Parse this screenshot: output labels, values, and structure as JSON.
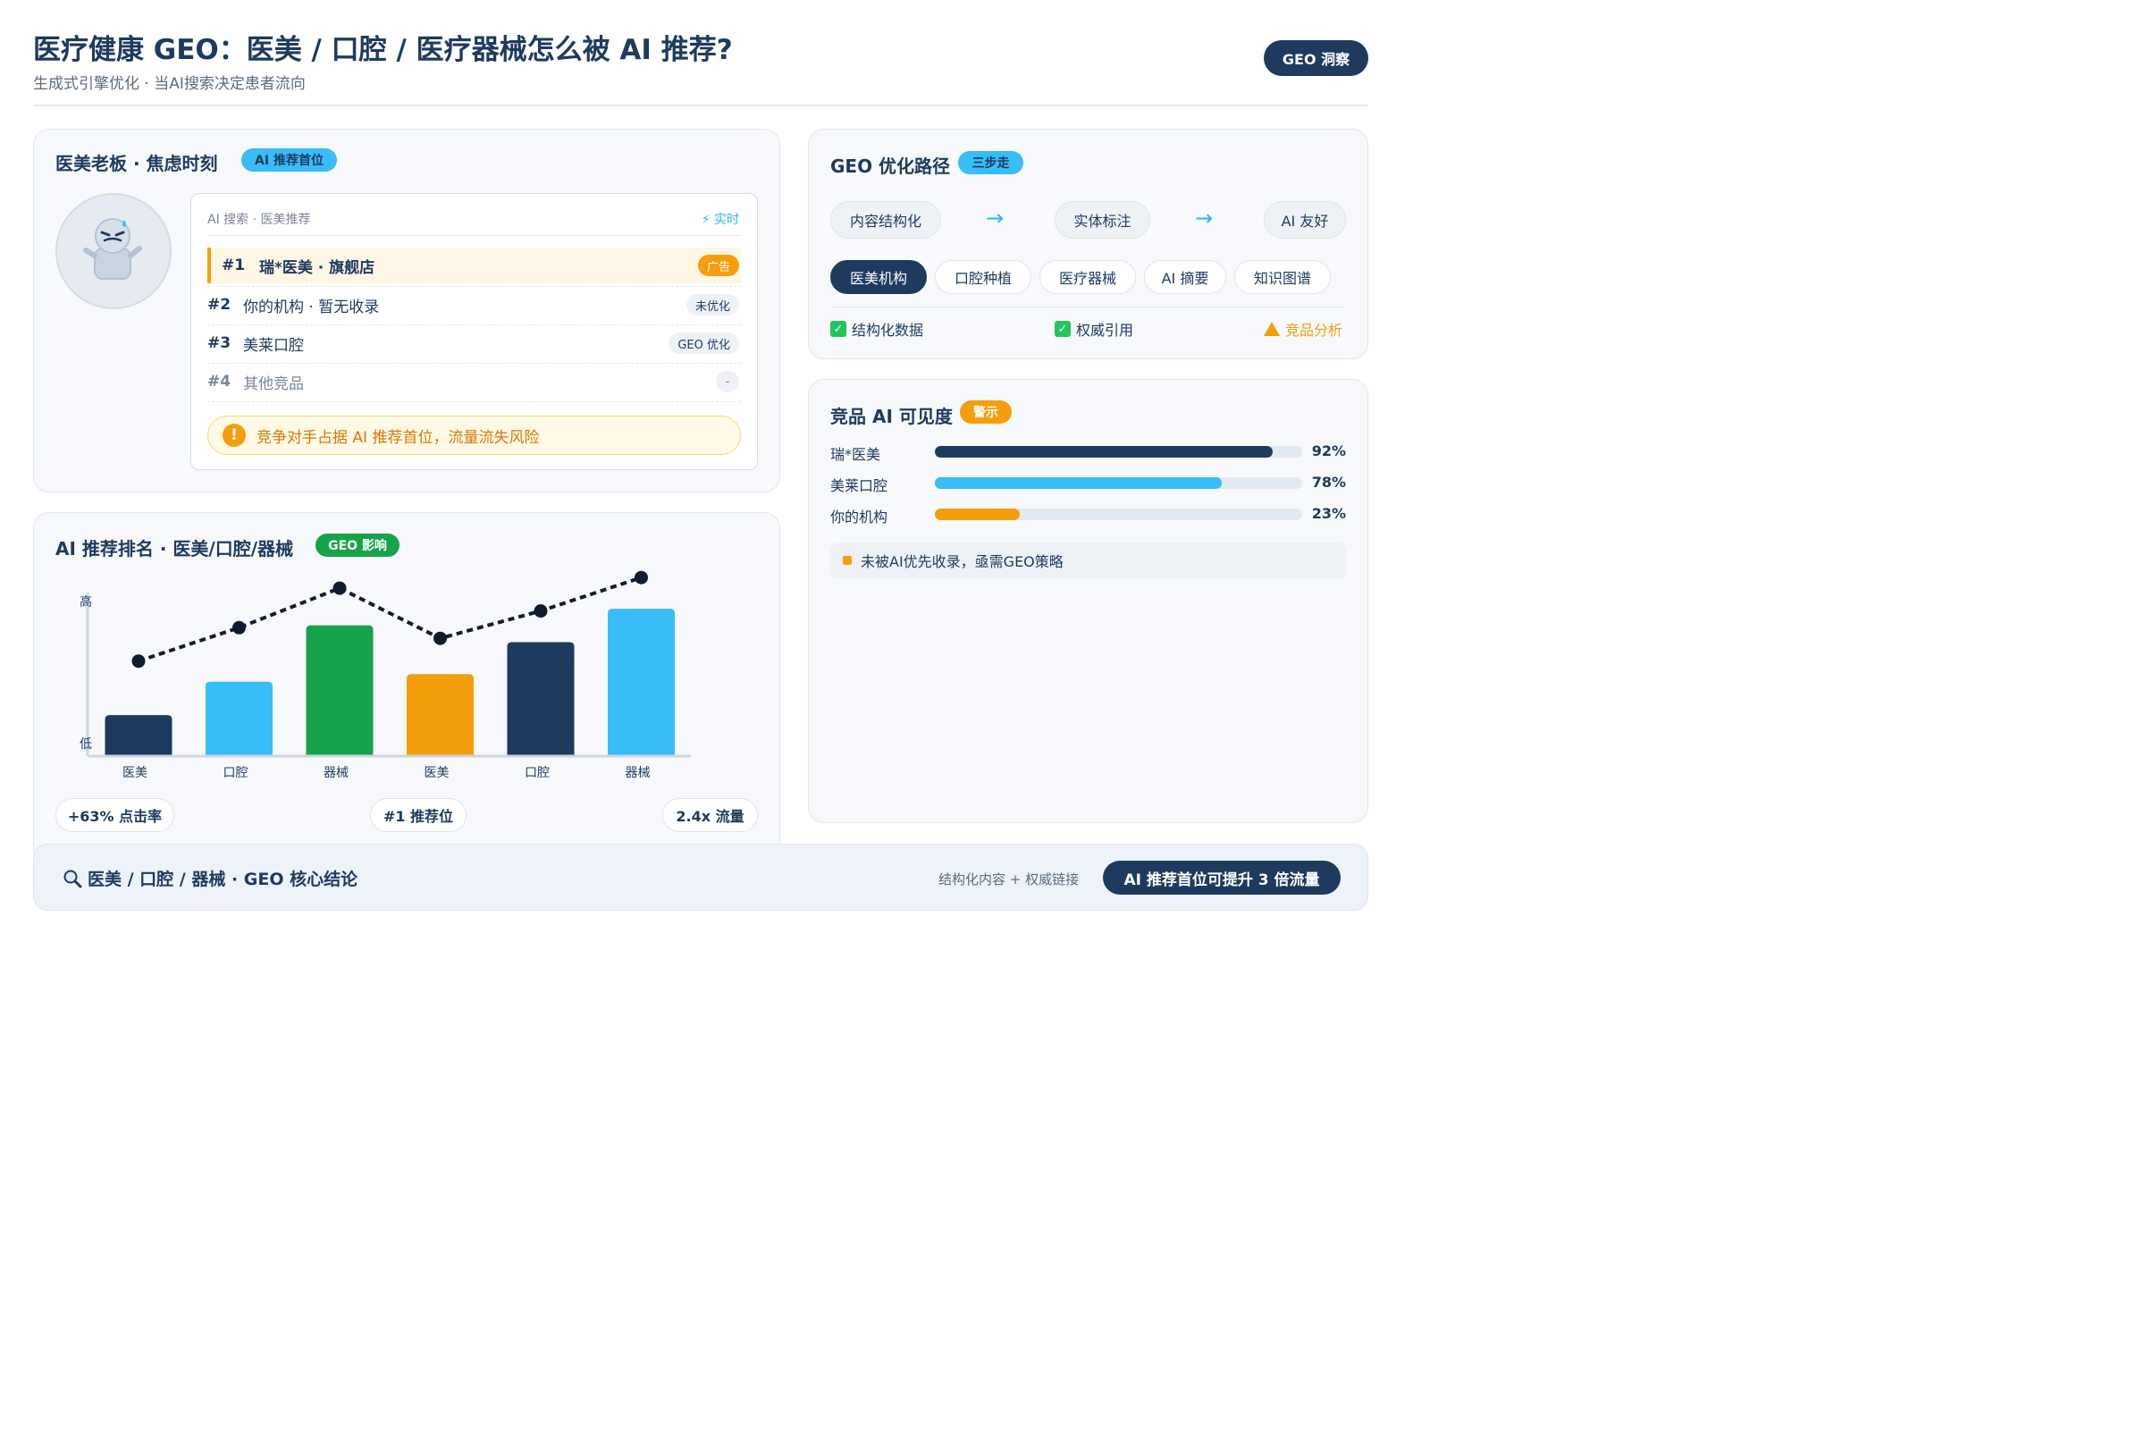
{
  "header": {
    "title": "医疗健康 GEO：医美 / 口腔 / 医疗器械怎么被 AI 推荐?",
    "subtitle": "生成式引擎优化 · 当AI搜索决定患者流向",
    "badge": "GEO 洞察"
  },
  "anxiety_card": {
    "title": "医美老板 · 焦虑时刻",
    "pill": "AI 推荐首位",
    "search": {
      "head": "AI 搜索 · 医美推荐",
      "live": "⚡ 实时",
      "results": [
        {
          "rank": "#1",
          "name": "瑞*医美 · 旗舰店",
          "tag": "广告"
        },
        {
          "rank": "#2",
          "name": "你的机构 · 暂无收录",
          "tag": "未优化"
        },
        {
          "rank": "#3",
          "name": "美莱口腔",
          "tag": "GEO 优化"
        },
        {
          "rank": "#4",
          "name": "其他竞品",
          "tag": "-"
        }
      ],
      "warning": "竞争对手占据 AI 推荐首位，流量流失风险"
    }
  },
  "ranking_card": {
    "title": "AI 推荐排名 · 医美/口腔/器械",
    "pill": "GEO 影响",
    "stats": [
      "+63% 点击率",
      "#1 推荐位",
      "2.4x 流量"
    ]
  },
  "chart_data": {
    "type": "bar",
    "categories": [
      "医美",
      "口腔",
      "器械",
      "医美",
      "口腔",
      "器械"
    ],
    "values": [
      0.27,
      0.49,
      0.86,
      0.54,
      0.75,
      0.97
    ],
    "line_values": [
      0.49,
      0.71,
      0.97,
      0.64,
      0.82,
      1.04
    ],
    "bar_colors": [
      "#1e3a5f",
      "#38bdf8",
      "#16a34a",
      "#f59e0b",
      "#1e3a5f",
      "#38bdf8"
    ],
    "ylabel_high": "高",
    "ylabel_low": "低",
    "ylim": [
      0,
      1.1
    ],
    "grid": false
  },
  "path_card": {
    "title": "GEO 优化路径",
    "pill": "三步走",
    "steps": [
      "内容结构化",
      "实体标注",
      "AI 友好"
    ],
    "arrow": "→",
    "chips": [
      "医美机构",
      "口腔种植",
      "医疗器械",
      "AI 摘要",
      "知识图谱"
    ],
    "checks": [
      "结构化数据",
      "权威引用",
      "竞品分析"
    ]
  },
  "visibility_card": {
    "title": "竞品 AI 可见度",
    "pill": "警示",
    "items": [
      {
        "name": "瑞*医美",
        "value": 92,
        "label": "92%",
        "color": "#1e3a5f"
      },
      {
        "name": "美莱口腔",
        "value": 78,
        "label": "78%",
        "color": "#38bdf8"
      },
      {
        "name": "你的机构",
        "value": 23,
        "label": "23%",
        "color": "#f59e0b"
      }
    ],
    "note": "未被AI优先收录，亟需GEO策略"
  },
  "footer": {
    "title": "医美 / 口腔 / 器械 · GEO 核心结论",
    "hint": "结构化内容 + 权威链接",
    "cta": "AI 推荐首位可提升 3 倍流量"
  },
  "colors": {
    "navy": "#1e3a5f",
    "sky": "#38bdf8",
    "orange": "#f59e0b",
    "green": "#16a34a"
  }
}
